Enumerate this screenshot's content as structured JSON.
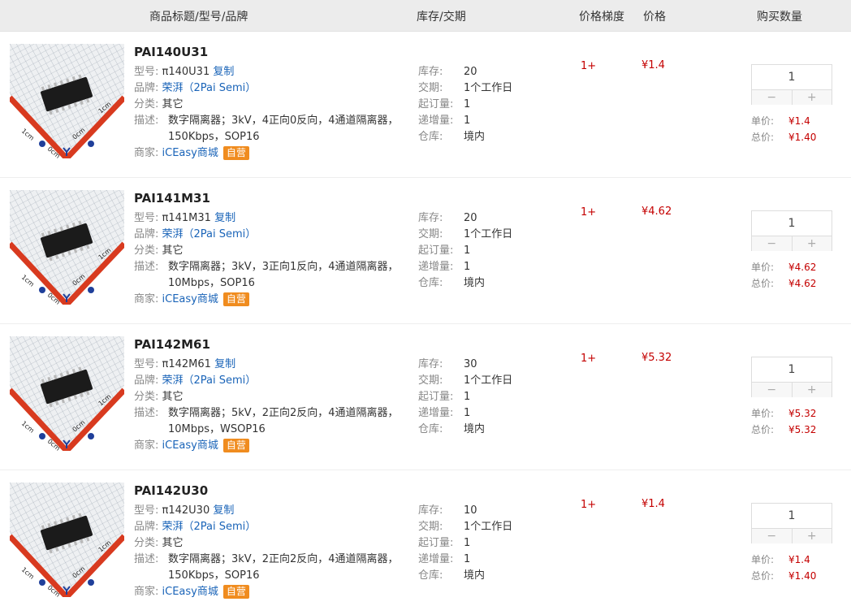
{
  "header": {
    "col_title": "商品标题/型号/品牌",
    "col_stock": "库存/交期",
    "col_tier": "价格梯度",
    "col_price": "价格",
    "col_qty": "购买数量"
  },
  "labels": {
    "model": "型号:",
    "copy": "复制",
    "brand": "品牌:",
    "category": "分类:",
    "desc": "描述:",
    "merchant": "商家:",
    "stock": "库存:",
    "lead": "交期:",
    "min_order": "起订量:",
    "increment": "递增量:",
    "warehouse": "仓库:",
    "unit_price": "单价:",
    "total_price": "总价:",
    "minus": "−",
    "plus": "+",
    "ruler_cm": "1cm",
    "ruler_zero": "0cm"
  },
  "products": [
    {
      "title": "PAI140U31",
      "model": "π140U31",
      "brand": "荣湃（2Pai Semi）",
      "category": "其它",
      "desc": "数字隔离器；3kV，4正向0反向，4通道隔离器，150Kbps，SOP16",
      "merchant": "iCEasy商城",
      "badge": "自营",
      "stock": "20",
      "lead": "1个工作日",
      "min_order": "1",
      "increment": "1",
      "warehouse": "境内",
      "tier": "1+",
      "price": "¥1.4",
      "qty": "1",
      "unit_price": "¥1.4",
      "total_price": "¥1.40"
    },
    {
      "title": "PAI141M31",
      "model": "π141M31",
      "brand": "荣湃（2Pai Semi）",
      "category": "其它",
      "desc": "数字隔离器；3kV，3正向1反向，4通道隔离器，10Mbps，SOP16",
      "merchant": "iCEasy商城",
      "badge": "自营",
      "stock": "20",
      "lead": "1个工作日",
      "min_order": "1",
      "increment": "1",
      "warehouse": "境内",
      "tier": "1+",
      "price": "¥4.62",
      "qty": "1",
      "unit_price": "¥4.62",
      "total_price": "¥4.62"
    },
    {
      "title": "PAI142M61",
      "model": "π142M61",
      "brand": "荣湃（2Pai Semi）",
      "category": "其它",
      "desc": "数字隔离器；5kV，2正向2反向，4通道隔离器，10Mbps，WSOP16",
      "merchant": "iCEasy商城",
      "badge": "自营",
      "stock": "30",
      "lead": "1个工作日",
      "min_order": "1",
      "increment": "1",
      "warehouse": "境内",
      "tier": "1+",
      "price": "¥5.32",
      "qty": "1",
      "unit_price": "¥5.32",
      "total_price": "¥5.32"
    },
    {
      "title": "PAI142U30",
      "model": "π142U30",
      "brand": "荣湃（2Pai Semi）",
      "category": "其它",
      "desc": "数字隔离器；3kV，2正向2反向，4通道隔离器，150Kbps，SOP16",
      "merchant": "iCEasy商城",
      "badge": "自营",
      "stock": "10",
      "lead": "1个工作日",
      "min_order": "1",
      "increment": "1",
      "warehouse": "境内",
      "tier": "1+",
      "price": "¥1.4",
      "qty": "1",
      "unit_price": "¥1.4",
      "total_price": "¥1.40"
    }
  ]
}
